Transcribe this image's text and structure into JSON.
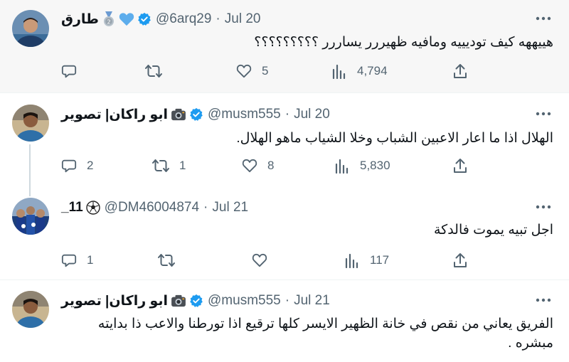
{
  "tweets": [
    {
      "name": "طارق",
      "badges": [
        "medal-2-icon",
        "blue-heart-icon"
      ],
      "verified": true,
      "handle": "@6arq29",
      "date": "Jul 20",
      "text": "هييههه كيف توديييه ومافيه ظهيررر يساررر ؟؟؟؟؟؟؟؟؟",
      "replies": "",
      "retweets": "",
      "likes": "5",
      "views": "4,794"
    },
    {
      "name": "ابو راكان| تصوير",
      "badges": [
        "camera-icon"
      ],
      "verified": true,
      "handle": "@musm555",
      "date": "Jul 20",
      "text": "الهلال اذا ما اعار الاعبين الشباب وخلا الشياب ماهو الهلال.",
      "replies": "2",
      "retweets": "1",
      "likes": "8",
      "views": "5,830"
    },
    {
      "name": "11_",
      "badges": [
        "soccer-ball-icon"
      ],
      "verified": false,
      "handle": "@DM46004874",
      "date": "Jul 21",
      "text": "اجل تبيه يموت فالدكة",
      "replies": "1",
      "retweets": "",
      "likes": "",
      "views": "117"
    },
    {
      "name": "ابو راكان| تصوير",
      "badges": [
        "camera-icon"
      ],
      "verified": true,
      "handle": "@musm555",
      "date": "Jul 21",
      "text_line1": "الفريق يعاني من نقص في خانة الظهير الايسر كلها ترقيع اذا تورطنا والاعب ذا بدايته",
      "text_line2": "مبشره ."
    }
  ],
  "separator": "·",
  "colors": {
    "verified": "#1d9bf0",
    "muted": "#536471",
    "thread_line": "#cfd9de"
  }
}
